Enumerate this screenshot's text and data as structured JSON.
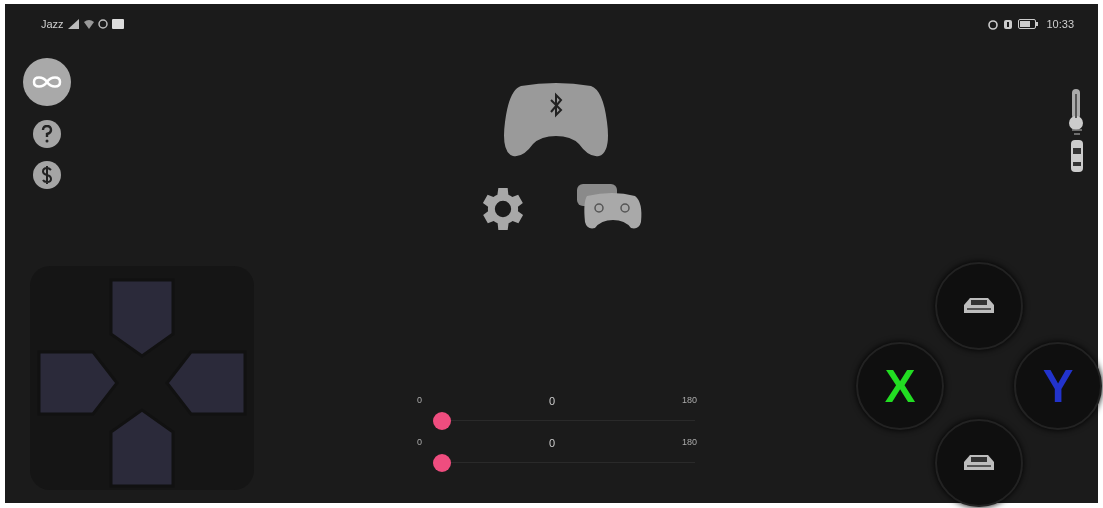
{
  "status_bar": {
    "carrier": "Jazz",
    "time": "10:33"
  },
  "sliders": [
    {
      "min_label": "0",
      "value": "0",
      "max_label": "180",
      "level": 0
    },
    {
      "min_label": "0",
      "value": "0",
      "max_label": "180",
      "level": 0
    }
  ],
  "face_buttons": [
    {
      "kind": "car"
    },
    {
      "kind": "letter",
      "label": "X",
      "color": "#22dd22"
    },
    {
      "kind": "letter",
      "label": "Y",
      "color": "#2233cc"
    },
    {
      "kind": "car"
    }
  ]
}
